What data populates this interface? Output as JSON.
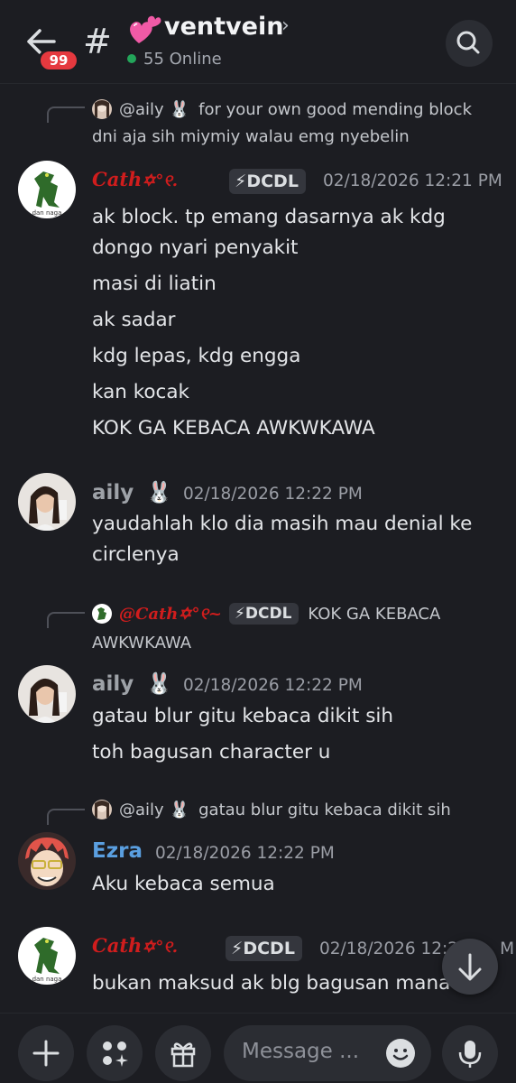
{
  "header": {
    "unread_count": "99",
    "channel_emoji": "💕",
    "channel_name": "ventvein",
    "online_count": "55 Online"
  },
  "messages": [
    {
      "reply": {
        "author": "@aily",
        "author_emoji": "🐰",
        "text_line1": "for your own good mending block",
        "text_line2": "dni aja sih miymiy walau emg nyebelin"
      },
      "author": "Cath",
      "author_decor": "✡︎°୧.",
      "avatar_caption": "dan naga",
      "tag": "⚡DCDL",
      "time": "02/18/2026 12:21 PM",
      "lines": [
        "ak block. tp emang dasarnya ak kdg",
        "dongo nyari penyakit",
        "masi di liatin",
        "ak sadar",
        "kdg lepas, kdg engga",
        "kan kocak",
        "KOK GA KEBACA AWKWKAWA"
      ]
    },
    {
      "author": "aily",
      "author_emoji": "🐰",
      "time": "02/18/2026 12:22 PM",
      "lines": [
        "yaudahlah klo dia masih mau denial ke",
        "circlenya"
      ]
    },
    {
      "reply": {
        "author": "@Cath",
        "author_decor": "✡︎°୧~",
        "tag": "⚡DCDL",
        "text_line1": "KOK GA KEBACA",
        "text_line2": "AWKWKAWA"
      },
      "author": "aily",
      "author_emoji": "🐰",
      "time": "02/18/2026 12:22 PM",
      "lines": [
        "gatau blur gitu kebaca dikit sih",
        "toh bagusan character u"
      ]
    },
    {
      "reply": {
        "author": "@aily",
        "author_emoji": "🐰",
        "text_line1": "gatau blur gitu kebaca dikit sih"
      },
      "author": "Ezra",
      "time": "02/18/2026 12:22 PM",
      "lines": [
        "Aku kebaca semua"
      ]
    },
    {
      "author": "Cath",
      "author_decor": "✡︎°୧.",
      "avatar_caption": "dan naga",
      "tag": "⚡DCDL",
      "time": "02/18/2026 12:2",
      "time_suffix": "M",
      "lines": [
        "bukan maksud ak blg bagusan mana"
      ]
    }
  ],
  "composer": {
    "placeholder": "Message ..."
  },
  "icons": {
    "back": "arrow-left-icon",
    "hash": "hash-icon",
    "search": "search-icon",
    "scroll_down": "arrow-down-icon",
    "plus": "plus-icon",
    "apps": "apps-icon",
    "gift": "gift-icon",
    "emoji": "emoji-icon",
    "mic": "microphone-icon"
  },
  "colors": {
    "background": "#1c1d22",
    "online": "#23a55a",
    "badge": "#e5393f",
    "cath_name": "#d01d1d",
    "ezra_name": "#5a9fe0"
  }
}
